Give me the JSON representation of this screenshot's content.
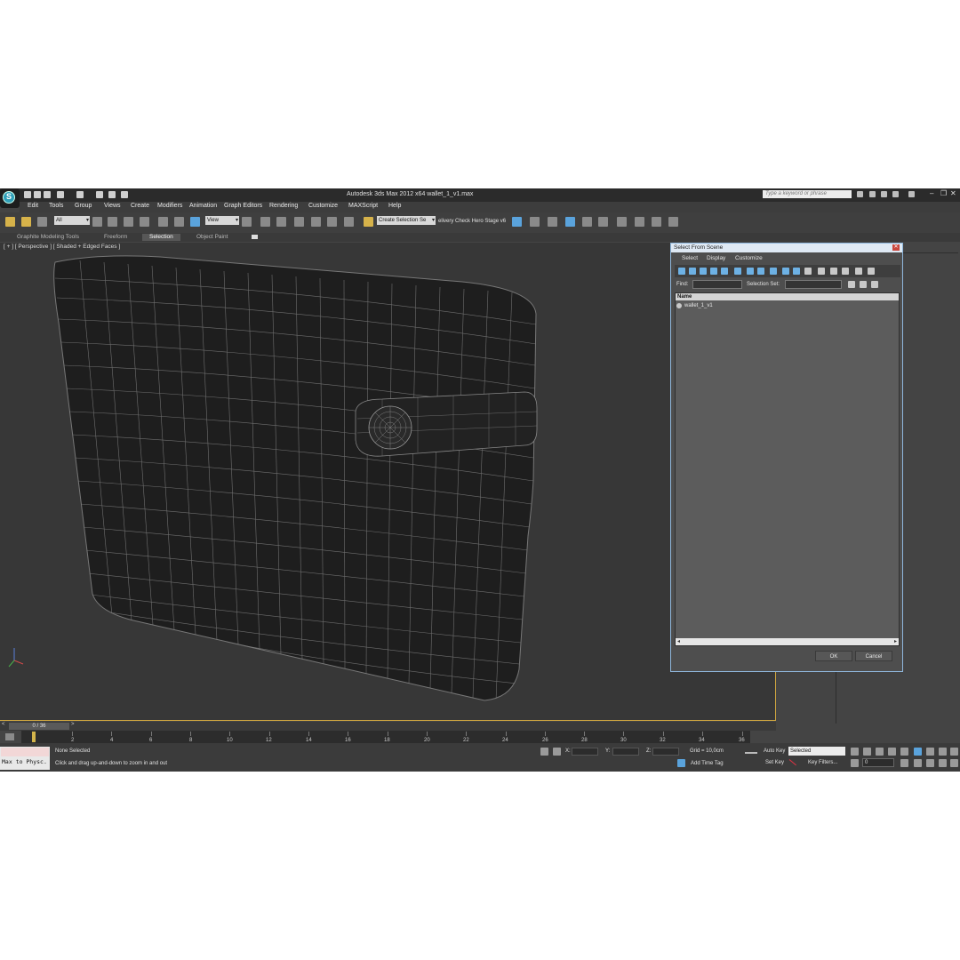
{
  "window": {
    "title": "Autodesk 3ds Max  2012 x64      wallet_1_v1.max",
    "search_placeholder": "Type a keyword or phrase"
  },
  "menu": [
    "Edit",
    "Tools",
    "Group",
    "Views",
    "Create",
    "Modifiers",
    "Animation",
    "Graph Editors",
    "Rendering",
    "Customize",
    "MAXScript",
    "Help"
  ],
  "toolbar": {
    "filter_value": "All",
    "refcoord_value": "View",
    "named_selection_value": "Create Selection Se",
    "script_text": "elivery Check  Hero Stage v6"
  },
  "ribbon": {
    "tabs": [
      "Graphite Modeling Tools",
      "Freeform",
      "Selection",
      "Object Paint"
    ],
    "active_tab": "Selection"
  },
  "viewport": {
    "label": "[ + ] [ Perspective ] [ Shaded + Edged Faces ]"
  },
  "dialog": {
    "title": "Select From Scene",
    "menu": [
      "Select",
      "Display",
      "Customize"
    ],
    "find_label": "Find:",
    "selection_set_label": "Selection Set:",
    "column_header": "Name",
    "items": [
      "wallet_1_v1"
    ],
    "ok_label": "OK",
    "cancel_label": "Cancel"
  },
  "timeline": {
    "slider_text": "0 / 36",
    "ticks": [
      "2",
      "4",
      "6",
      "8",
      "10",
      "12",
      "14",
      "16",
      "18",
      "20",
      "22",
      "24",
      "26",
      "28",
      "30",
      "32",
      "34",
      "36"
    ]
  },
  "status": {
    "maxscript_listener": "Max to Physc.",
    "selection_status": "None Selected",
    "prompt": "Click and drag up-and-down to zoom in and out",
    "x_label": "X:",
    "y_label": "Y:",
    "z_label": "Z:",
    "grid": "Grid = 10,0cm",
    "add_time_tag": "Add Time Tag",
    "auto_key": "Auto Key",
    "set_key": "Set Key",
    "selected_value": "Selected",
    "key_filters": "Key Filters...",
    "frame_value": "0"
  },
  "colors": {
    "viewport_border": "#cfa640",
    "accent_blue": "#5aa3dc",
    "dialog_border": "#8fb7dc"
  }
}
